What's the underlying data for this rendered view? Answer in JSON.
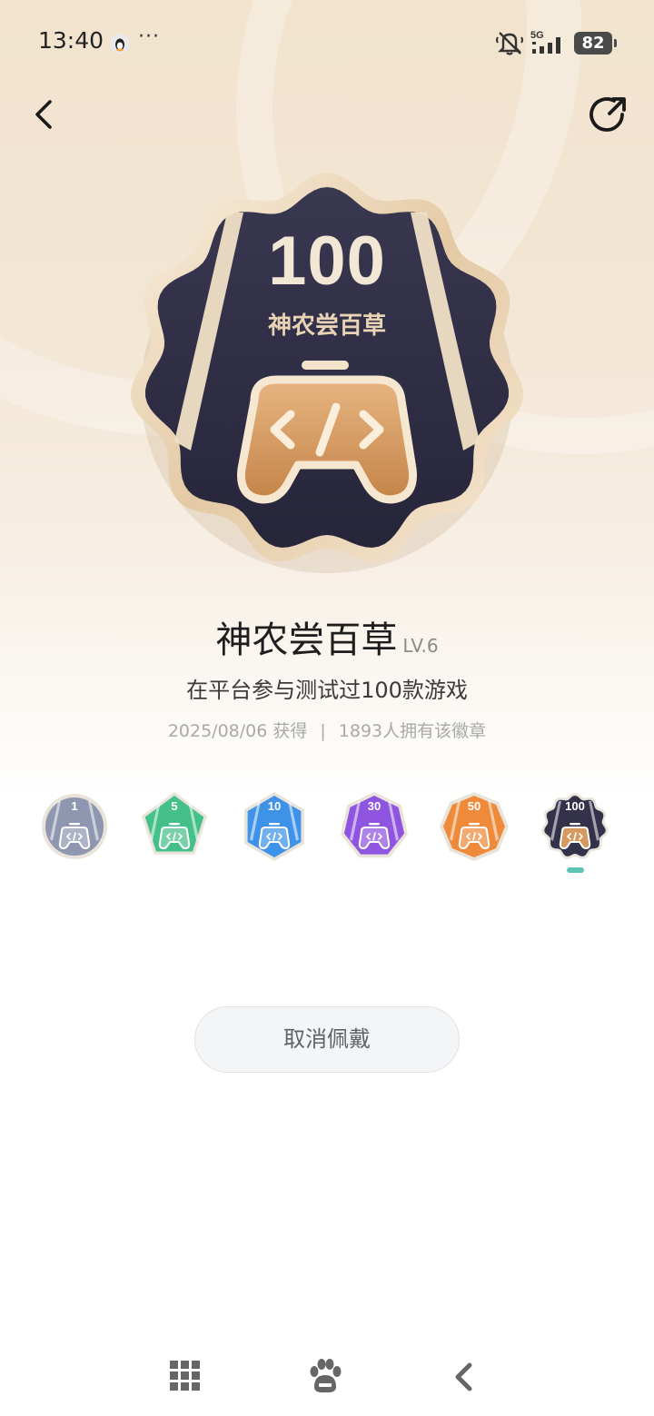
{
  "status_bar": {
    "time": "13:40",
    "more": "···",
    "network": "5G",
    "battery": "82"
  },
  "header": {
    "back_icon": "chevron-left-icon",
    "share_icon": "share-arrow-icon"
  },
  "badge": {
    "display_value": "100",
    "display_name": "神农尝百草",
    "title": "神农尝百草",
    "level": "LV.6",
    "description": "在平台参与测试过100款游戏",
    "obtained_date": "2025/08/06 获得",
    "separator": "|",
    "owners": "1893人拥有该徽章"
  },
  "levels": [
    {
      "value": "1",
      "color": "#8f96b0",
      "shape": "circle"
    },
    {
      "value": "5",
      "color": "#46c08a",
      "shape": "pentagon"
    },
    {
      "value": "10",
      "color": "#3e93e8",
      "shape": "hexagon"
    },
    {
      "value": "30",
      "color": "#8f55e0",
      "shape": "heptagon"
    },
    {
      "value": "50",
      "color": "#ee8a3a",
      "shape": "octagon"
    },
    {
      "value": "100",
      "color": "#34324a",
      "shape": "flower"
    }
  ],
  "active_level_index": 5,
  "actions": {
    "unwear_label": "取消佩戴"
  },
  "nav": {
    "apps_icon": "grid-apps-icon",
    "home_icon": "paw-icon",
    "back_icon": "nav-back-icon"
  },
  "colors": {
    "active_indicator": "#5cc5b6",
    "badge_dark": "#2f2e44",
    "badge_gold": "#d4a06a"
  }
}
